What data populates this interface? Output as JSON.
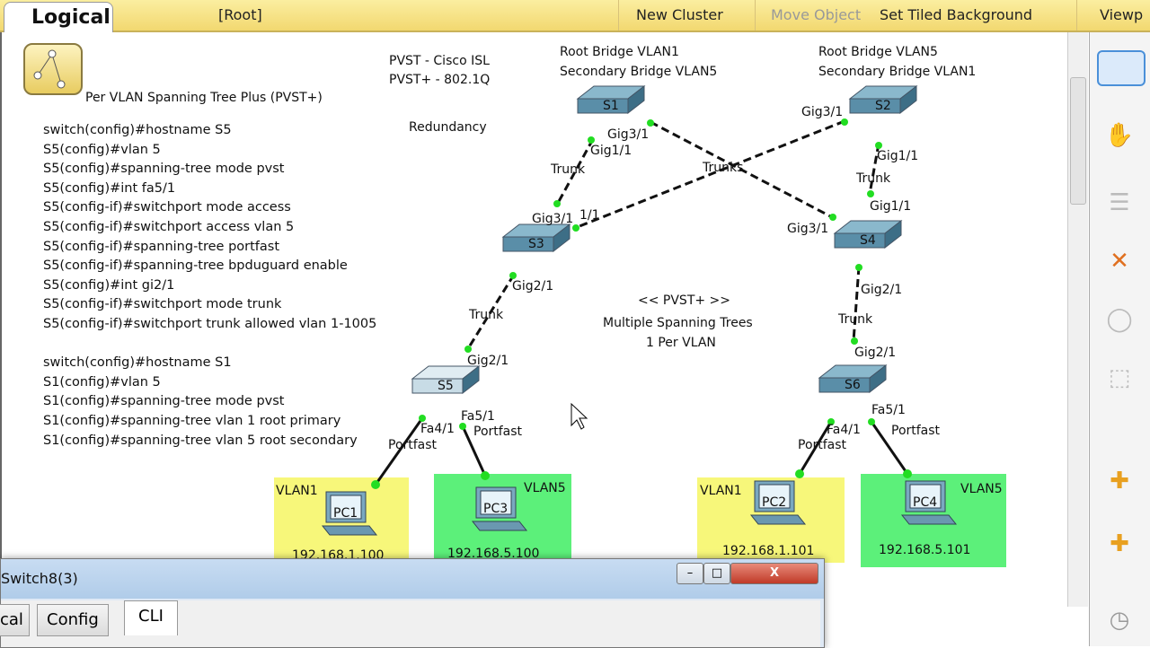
{
  "topbar": {
    "mode_tab": "Logical",
    "breadcrumb": "[Root]",
    "new_cluster": "New Cluster",
    "move_object": "Move Object",
    "set_tiled_background": "Set Tiled Background",
    "viewport": "Viewp"
  },
  "notes": {
    "title": "Per VLAN Spanning Tree Plus  (PVST+)",
    "pvst_isl": "PVST - Cisco ISL",
    "pvst_plus_dot1q": "PVST+ - 802.1Q",
    "redundancy": "Redundancy",
    "s1_role_1": "Root Bridge VLAN1",
    "s1_role_2": "Secondary Bridge VLAN5",
    "s2_role_1": "Root Bridge VLAN5",
    "s2_role_2": "Secondary Bridge VLAN1",
    "pvst_center_1": "<< PVST+ >>",
    "pvst_center_2": "Multiple Spanning Trees",
    "pvst_center_3": "1 Per VLAN"
  },
  "config_lines": [
    "switch(config)#hostname S5",
    "S5(config)#vlan 5",
    "S5(config)#spanning-tree mode pvst",
    "S5(config)#int fa5/1",
    "S5(config-if)#switchport mode access",
    "S5(config-if)#switchport access vlan 5",
    "S5(config-if)#spanning-tree portfast",
    "S5(config-if)#spanning-tree bpduguard enable",
    "S5(config)#int gi2/1",
    "S5(config-if)#switchport mode trunk",
    "S5(config-if)#switchport trunk allowed vlan 1-1005",
    "",
    "switch(config)#hostname S1",
    "S1(config)#vlan 5",
    "S1(config)#spanning-tree mode pvst",
    "S1(config)#spanning-tree vlan 1 root primary",
    "S1(config)#spanning-tree vlan 5 root secondary"
  ],
  "switches": {
    "s1": "S1",
    "s2": "S2",
    "s3": "S3",
    "s4": "S4",
    "s5": "S5",
    "s6": "S6"
  },
  "pcs": {
    "pc1": {
      "name": "PC1",
      "vlan": "VLAN1",
      "ip": "192.168.1.100"
    },
    "pc3": {
      "name": "PC3",
      "vlan": "VLAN5",
      "ip": "192.168.5.100"
    },
    "pc2": {
      "name": "PC2",
      "vlan": "VLAN1",
      "ip": "192.168.1.101"
    },
    "pc4": {
      "name": "PC4",
      "vlan": "VLAN5",
      "ip": "192.168.5.101"
    }
  },
  "labels": {
    "s1_gig31": "Gig3/1",
    "s1_gig11": "Gig1/1",
    "trunk1": "Trunk",
    "s3_gig31": "Gig3/1",
    "s3_11": "1/1",
    "trunks": "Trunks",
    "s2_gig31": "Gig3/1",
    "s2_gig11": "Gig1/1",
    "trunk2": "Trunk",
    "s4_gig11": "Gig1/1",
    "s4_gig31": "Gig3/1",
    "s3_gig21": "Gig2/1",
    "trunk3": "Trunk",
    "s5_gig21": "Gig2/1",
    "s4_gig21": "Gig2/1",
    "trunk4": "Trunk",
    "s6_gig21": "Gig2/1",
    "s5_fa41": "Fa4/1",
    "s5_fa51": "Fa5/1",
    "s5_portfast1": "Portfast",
    "s5_portfast2": "Portfast",
    "s6_fa41": "Fa4/1",
    "s6_fa51": "Fa5/1",
    "s6_portfast1": "Portfast",
    "s6_portfast2": "Portfast"
  },
  "colors": {
    "vlan1": "#f7f77a",
    "vlan5": "#5cf07a",
    "link_up": "#22dd22",
    "switch": "#5a8ea8"
  },
  "dialog": {
    "title": "Switch8(3)",
    "minimize": "–",
    "maximize": "□",
    "close": "X",
    "tabs": [
      "cal",
      "Config",
      "CLI"
    ],
    "active_tab": "CLI"
  }
}
